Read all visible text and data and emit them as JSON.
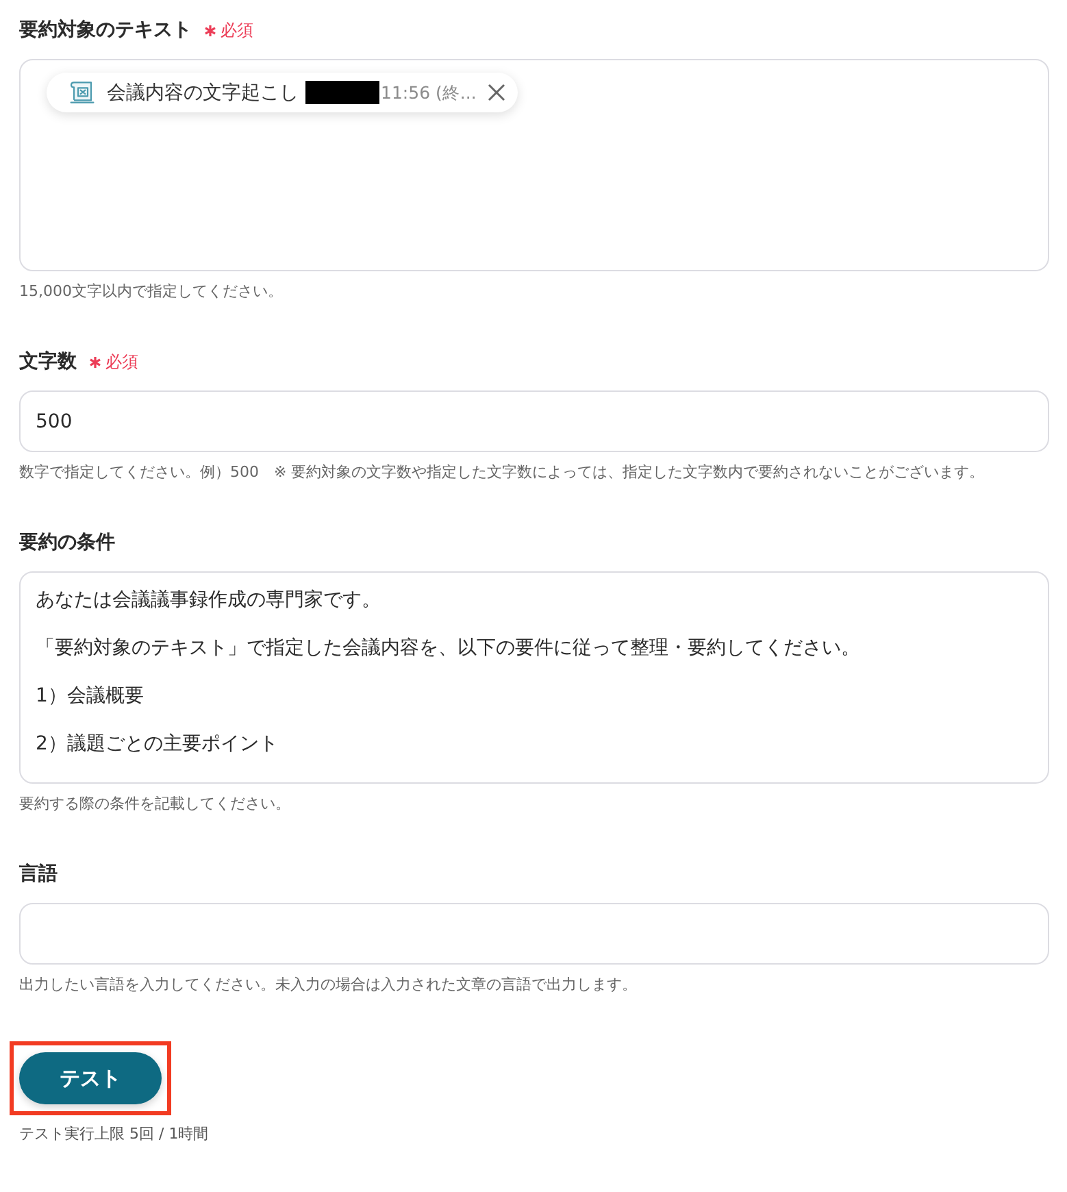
{
  "fields": [
    {
      "kind": "chips",
      "label": "要約対象のテキスト",
      "required": true,
      "required_text": "必須",
      "chips": [
        {
          "title": "会議内容の文字起こし",
          "redacted": true,
          "detail": "11:56 (終..."
        }
      ],
      "help": "15,000文字以内で指定してください。"
    },
    {
      "kind": "input",
      "label": "文字数",
      "required": true,
      "required_text": "必須",
      "value": "500",
      "help": "数字で指定してください。例）500　※ 要約対象の文字数や指定した文字数によっては、指定した文字数内で要約されないことがございます。"
    },
    {
      "kind": "textarea",
      "label": "要約の条件",
      "required": false,
      "lines": [
        "あなたは会議議事録作成の専門家です。",
        "「要約対象のテキスト」で指定した会議内容を、以下の要件に従って整理・要約してください。",
        "1）会議概要",
        "2）議題ごとの主要ポイント"
      ],
      "help": "要約する際の条件を記載してください。"
    },
    {
      "kind": "input",
      "label": "言語",
      "required": false,
      "help": "出力したい言語を入力してください。未入力の場合は入力された文章の言語で出力します。"
    }
  ],
  "test_button": {
    "label": "テスト",
    "highlighted": true
  },
  "limit_note": "テスト実行上限 5回 / 1時間"
}
